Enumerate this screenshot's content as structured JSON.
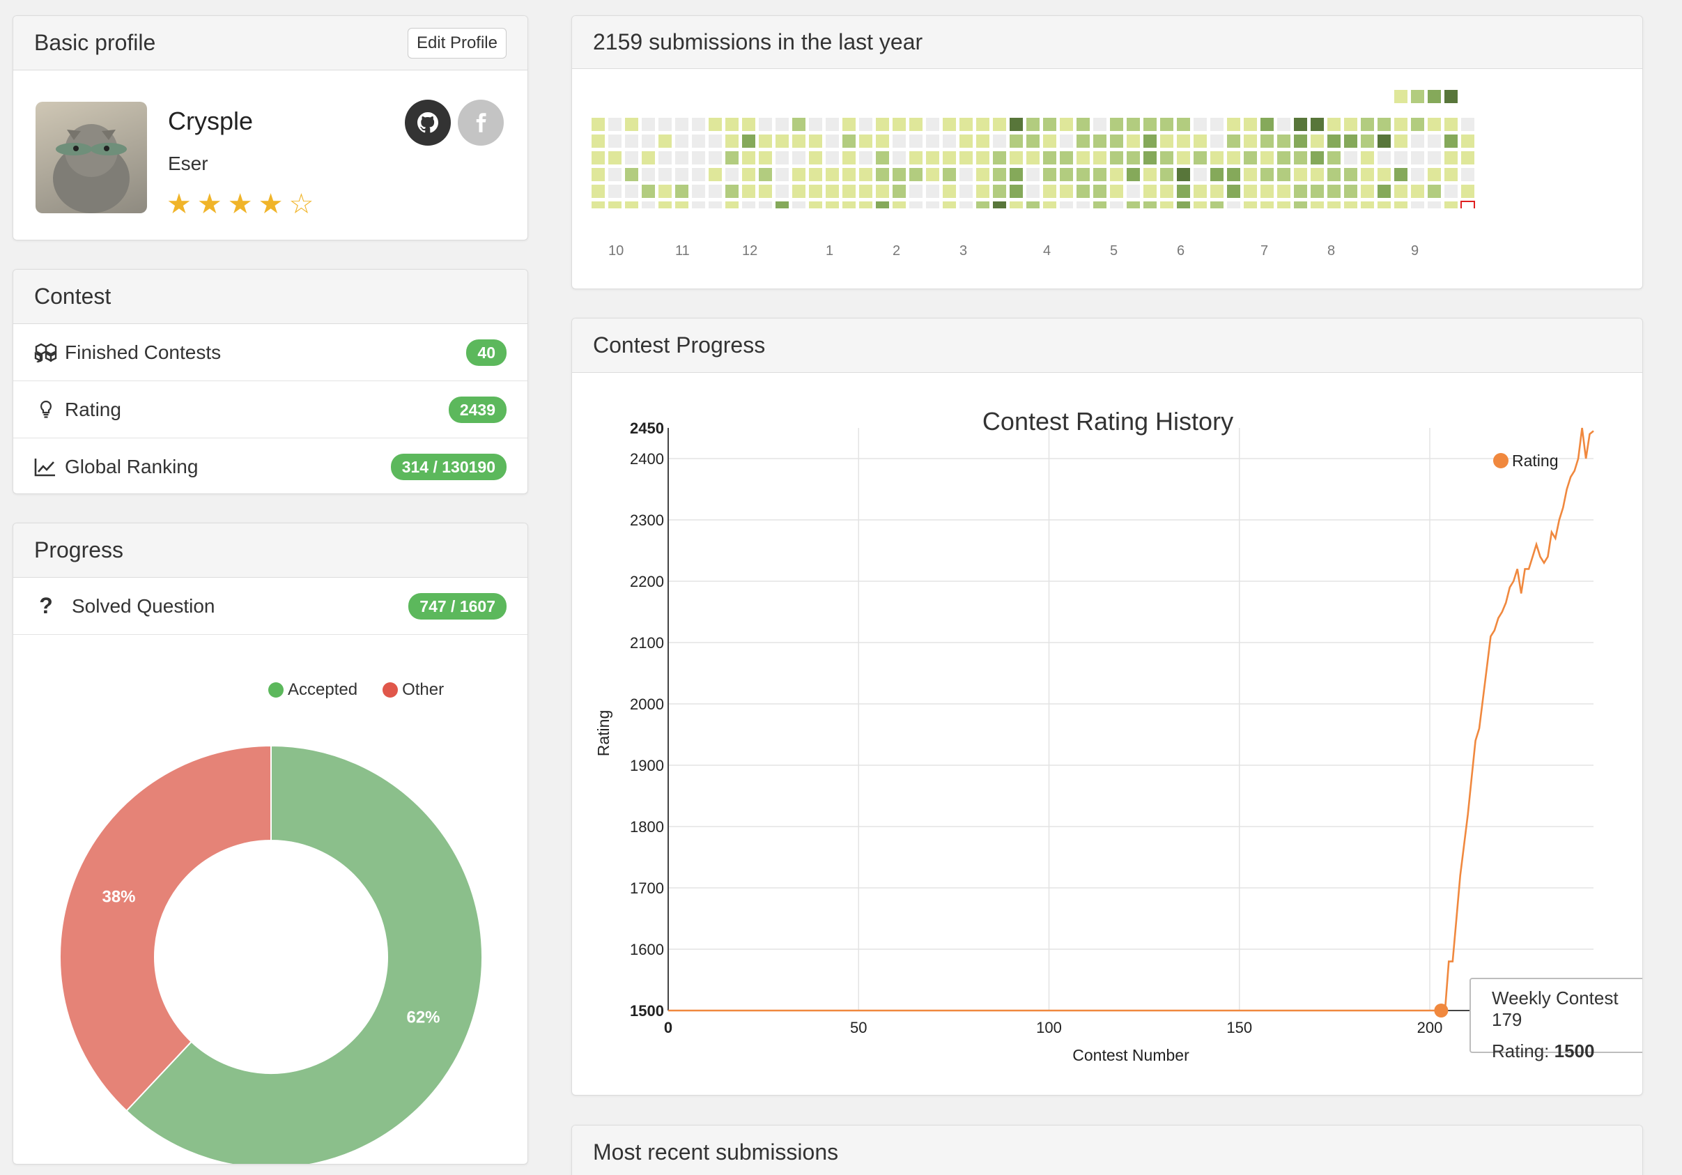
{
  "profile": {
    "header": "Basic profile",
    "edit_label": "Edit Profile",
    "username": "Crysple",
    "realname": "Eser",
    "stars_filled": 4,
    "stars_total": 5
  },
  "contest": {
    "header": "Contest",
    "rows": [
      {
        "label": "Finished Contests",
        "value": "40",
        "icon": "cubes-icon"
      },
      {
        "label": "Rating",
        "value": "2439",
        "icon": "lightbulb-icon"
      },
      {
        "label": "Global Ranking",
        "value": "314 / 130190",
        "icon": "line-chart-icon"
      }
    ]
  },
  "progress": {
    "header": "Progress",
    "solved_label": "Solved Question",
    "solved_value": "747 / 1607",
    "legend": [
      "Accepted",
      "Other"
    ],
    "slices": [
      {
        "name": "Accepted",
        "value": 62,
        "label": "62%",
        "color": "#8bbf8b"
      },
      {
        "name": "Other",
        "value": 38,
        "label": "38%",
        "color": "#e58377"
      }
    ]
  },
  "submissions": {
    "header": "2159 submissions in the last year",
    "month_labels": [
      "10",
      "11",
      "12",
      "1",
      "2",
      "3",
      "4",
      "5",
      "6",
      "7",
      "8",
      "9"
    ],
    "colors": [
      "#ececec",
      "#dfe79a",
      "#b2cc7f",
      "#85a95a",
      "#58763a"
    ]
  },
  "contest_progress": {
    "header": "Contest Progress",
    "chart_data": {
      "type": "line",
      "title": "Contest Rating History",
      "xlabel": "Contest Number",
      "ylabel": "Rating",
      "xlim": [
        0,
        243
      ],
      "ylim": [
        1500,
        2450
      ],
      "x_ticks": [
        0,
        50,
        100,
        150,
        200
      ],
      "y_ticks": [
        1500,
        1600,
        1700,
        1800,
        1900,
        2000,
        2100,
        2200,
        2300,
        2400,
        2450
      ],
      "grid": true,
      "legend_position": "top-right",
      "series": [
        {
          "name": "Rating",
          "color": "#f0883e",
          "points": [
            [
              0,
              1500
            ],
            [
              203,
              1500
            ],
            [
              204,
              1500
            ],
            [
              205,
              1580
            ],
            [
              206,
              1580
            ],
            [
              207,
              1650
            ],
            [
              208,
              1720
            ],
            [
              209,
              1770
            ],
            [
              210,
              1820
            ],
            [
              211,
              1880
            ],
            [
              212,
              1940
            ],
            [
              213,
              1960
            ],
            [
              214,
              2010
            ],
            [
              215,
              2060
            ],
            [
              216,
              2110
            ],
            [
              217,
              2120
            ],
            [
              218,
              2140
            ],
            [
              219,
              2150
            ],
            [
              220,
              2165
            ],
            [
              221,
              2190
            ],
            [
              222,
              2200
            ],
            [
              223,
              2220
            ],
            [
              224,
              2180
            ],
            [
              225,
              2220
            ],
            [
              226,
              2220
            ],
            [
              227,
              2240
            ],
            [
              228,
              2260
            ],
            [
              229,
              2240
            ],
            [
              230,
              2230
            ],
            [
              231,
              2240
            ],
            [
              232,
              2280
            ],
            [
              233,
              2270
            ],
            [
              234,
              2300
            ],
            [
              235,
              2320
            ],
            [
              236,
              2350
            ],
            [
              237,
              2370
            ],
            [
              238,
              2380
            ],
            [
              239,
              2400
            ],
            [
              240,
              2450
            ],
            [
              241,
              2400
            ],
            [
              242,
              2440
            ],
            [
              243,
              2445
            ]
          ]
        }
      ]
    },
    "tooltip": {
      "title": "Weekly Contest 179",
      "label": "Rating:",
      "value": "1500"
    }
  },
  "recent": {
    "header": "Most recent submissions"
  }
}
